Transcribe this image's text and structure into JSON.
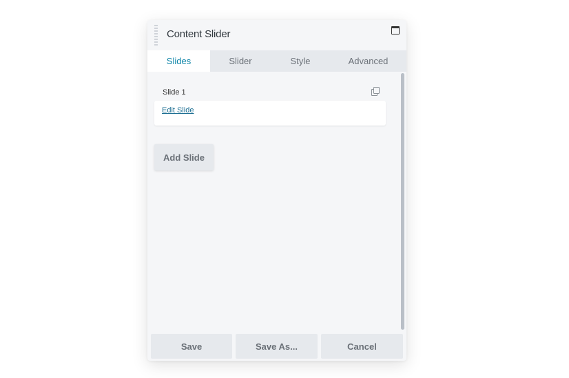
{
  "dialog": {
    "title": "Content Slider",
    "maximize_icon": "window-maximize-icon",
    "drag_icon": "drag-handle-icon"
  },
  "tabs": [
    {
      "label": "Slides",
      "active": true
    },
    {
      "label": "Slider",
      "active": false
    },
    {
      "label": "Style",
      "active": false
    },
    {
      "label": "Advanced",
      "active": false
    }
  ],
  "slides": [
    {
      "label": "Slide 1",
      "edit_link": "Edit Slide",
      "copy_icon": "copy-icon"
    }
  ],
  "add_slide_label": "Add Slide",
  "footer": {
    "save": "Save",
    "save_as": "Save As...",
    "cancel": "Cancel"
  },
  "colors": {
    "accent": "#0e85a8",
    "link": "#1c6e92",
    "panel_bg": "#f5f6f8",
    "tab_bar_bg": "#e6e9ed",
    "button_bg": "#e6e9ed"
  }
}
